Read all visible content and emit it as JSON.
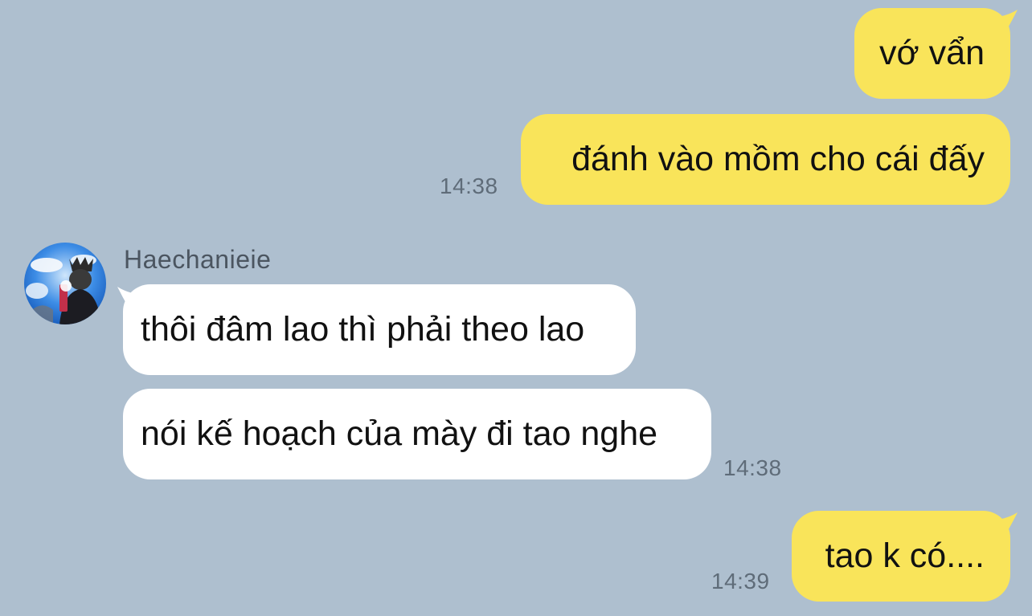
{
  "conversation": {
    "messages": [
      {
        "direction": "outgoing",
        "text": "vớ vẩn"
      },
      {
        "direction": "outgoing",
        "text": "đánh vào mồm cho cái đấy",
        "time": "14:38"
      },
      {
        "direction": "incoming",
        "text": "thôi đâm lao thì phải theo lao"
      },
      {
        "direction": "incoming",
        "text": "nói kế hoạch của mày đi tao nghe",
        "time": "14:38"
      },
      {
        "direction": "outgoing",
        "text": "tao k có....",
        "time": "14:39"
      }
    ],
    "contact": {
      "name": "Haechanieie",
      "avatar_icon": "profile-photo"
    }
  },
  "colors": {
    "background": "#aebfcf",
    "outgoing_bubble": "#f9e45a",
    "incoming_bubble": "#ffffff",
    "timestamp": "#5f6c79",
    "sender_name": "#4b5560"
  }
}
